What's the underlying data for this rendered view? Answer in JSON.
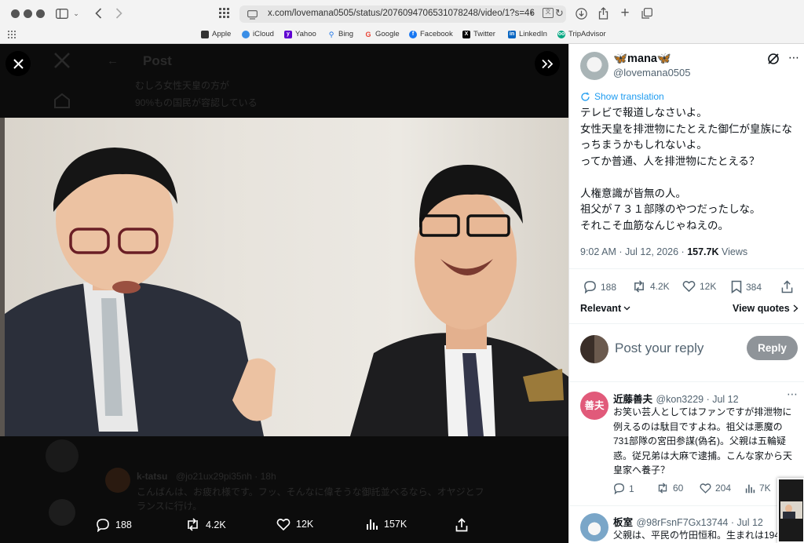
{
  "browser": {
    "url": "x.com/lovemana0505/status/2076094706531078248/video/1?s=46",
    "bookmarks": [
      {
        "label": "Apple",
        "icon": "apple-icon",
        "color": "#333333"
      },
      {
        "label": "iCloud",
        "icon": "icloud-icon",
        "color": "#3a8ee6"
      },
      {
        "label": "Yahoo",
        "icon": "yahoo-icon",
        "color": "#6001d2"
      },
      {
        "label": "Bing",
        "icon": "bing-icon",
        "color": "#1a73e8"
      },
      {
        "label": "Google",
        "icon": "google-icon",
        "color": "#ea4335"
      },
      {
        "label": "Facebook",
        "icon": "facebook-icon",
        "color": "#1877f2"
      },
      {
        "label": "Twitter",
        "icon": "x-icon",
        "color": "#000000"
      },
      {
        "label": "LinkedIn",
        "icon": "linkedin-icon",
        "color": "#0a66c2"
      },
      {
        "label": "TripAdvisor",
        "icon": "tripadvisor-icon",
        "color": "#00a680"
      }
    ]
  },
  "background": {
    "header_title": "Post",
    "text_lines": [
      "むしろ女性天皇の方が",
      "90%もの国民が容認している"
    ],
    "reply_user": "k-tatsu",
    "reply_handle": "@jo21ux29pi35nh · 18h",
    "reply_lines": [
      "こんばんは、お疲れ様です。フッ、そんなに偉そうな御託並べるなら、オヤジとフ",
      "ランスに行け。"
    ]
  },
  "video_bar": {
    "replies": "188",
    "reposts": "4.2K",
    "likes": "12K",
    "views": "157K"
  },
  "post": {
    "display_name": "🦋mana🦋",
    "handle": "@lovemana0505",
    "show_translation": "Show translation",
    "body_lines": [
      "テレビで報道しなさいよ。",
      "女性天皇を排泄物にたとえた御仁が皇族にな",
      "っちまうかもしれないよ。",
      "ってか普通、人を排泄物にたとえる？",
      "",
      "人権意識が皆無の人。",
      "祖父が７３１部隊のやつだったしな。",
      "それこそ血筋なんじゃねえの。"
    ],
    "timestamp": "9:02 AM · Jul 12, 2026 · ",
    "views_count": "157.7K",
    "views_label": " Views",
    "replies": "188",
    "reposts": "4.2K",
    "likes": "12K",
    "bookmarks": "384",
    "relevant": "Relevant",
    "view_quotes": "View quotes",
    "reply_placeholder": "Post your reply",
    "reply_button": "Reply"
  },
  "replies": [
    {
      "avatar_text": "善夫",
      "name": "近藤善夫",
      "handle": "@kon3229 · Jul 12",
      "lines": [
        "お笑い芸人としてはファンですが排泄物に",
        "例えるのは駄目ですよね。祖父は悪魔の",
        "731部隊の宮田参謀(偽名)。父親は五輪疑",
        "惑。従兄弟は大麻で逮捕。こんな家から天",
        "皇家へ養子？"
      ],
      "replies": "1",
      "reposts": "60",
      "likes": "204",
      "views": "7K"
    },
    {
      "avatar_text": "",
      "name": "板室",
      "handle": "@98rFsnF7Gx13744 · Jul 12",
      "lines": [
        "父親は、平民の竹田恒和。生まれは194"
      ]
    }
  ]
}
